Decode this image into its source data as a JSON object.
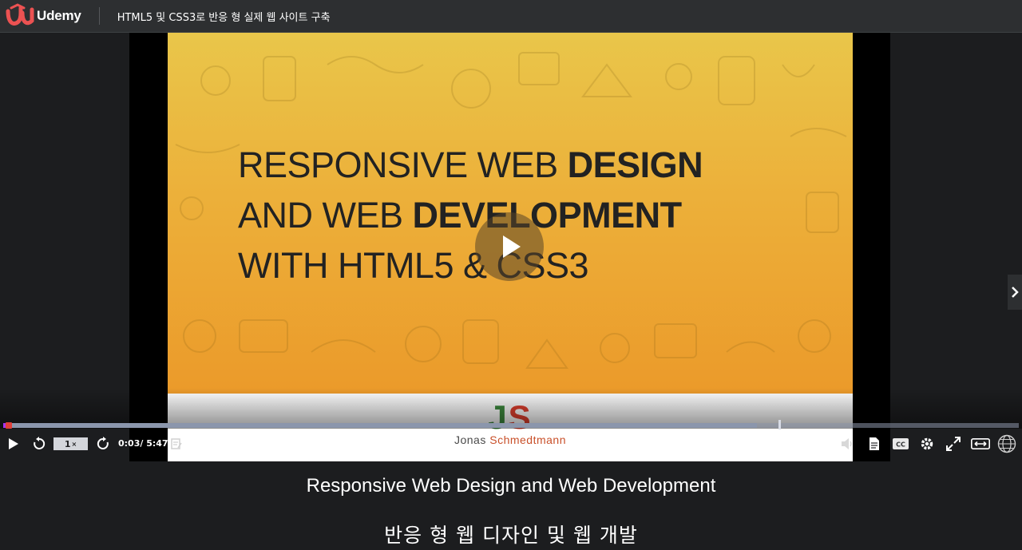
{
  "header": {
    "brand": "Udemy",
    "course_title": "HTML5 및 CSS3로 반응 형 실제 웹 사이트 구축"
  },
  "slide": {
    "line1_light": "RESPONSIVE WEB ",
    "line1_bold": "DESIGN",
    "line2_light": "AND WEB ",
    "line2_bold": "DEVELOPMENT",
    "line3_light": "WITH HTML5 & CSS3",
    "logo_j": "J",
    "logo_s": "S",
    "author_first": "Jonas",
    "author_last": "Schmedtmann"
  },
  "player": {
    "speed_value": "1",
    "speed_suffix": "×",
    "time_display": "0:03/ 5:47",
    "current_seconds": 3,
    "duration_seconds": 347,
    "buffered_fraction": 0.742,
    "accent_color": "#a435f0",
    "playhead_color": "#e0403a"
  },
  "captions": {
    "english": "Responsive Web Design and Web Development",
    "korean": "반응 형 웹 디자인 및 웹 개발"
  },
  "icons": {
    "logo": "udemy-logo-icon",
    "play_big": "play-overlay-icon",
    "next": "chevron-right-icon",
    "play": "play-icon",
    "rewind": "rewind-5-icon",
    "forward": "forward-5-icon",
    "notes": "add-note-icon",
    "volume": "volume-icon",
    "transcript": "transcript-icon",
    "cc": "closed-captions-icon",
    "settings": "gear-icon",
    "fullscreen": "fullscreen-icon",
    "expand": "expand-width-icon",
    "globe": "language-globe-icon"
  }
}
